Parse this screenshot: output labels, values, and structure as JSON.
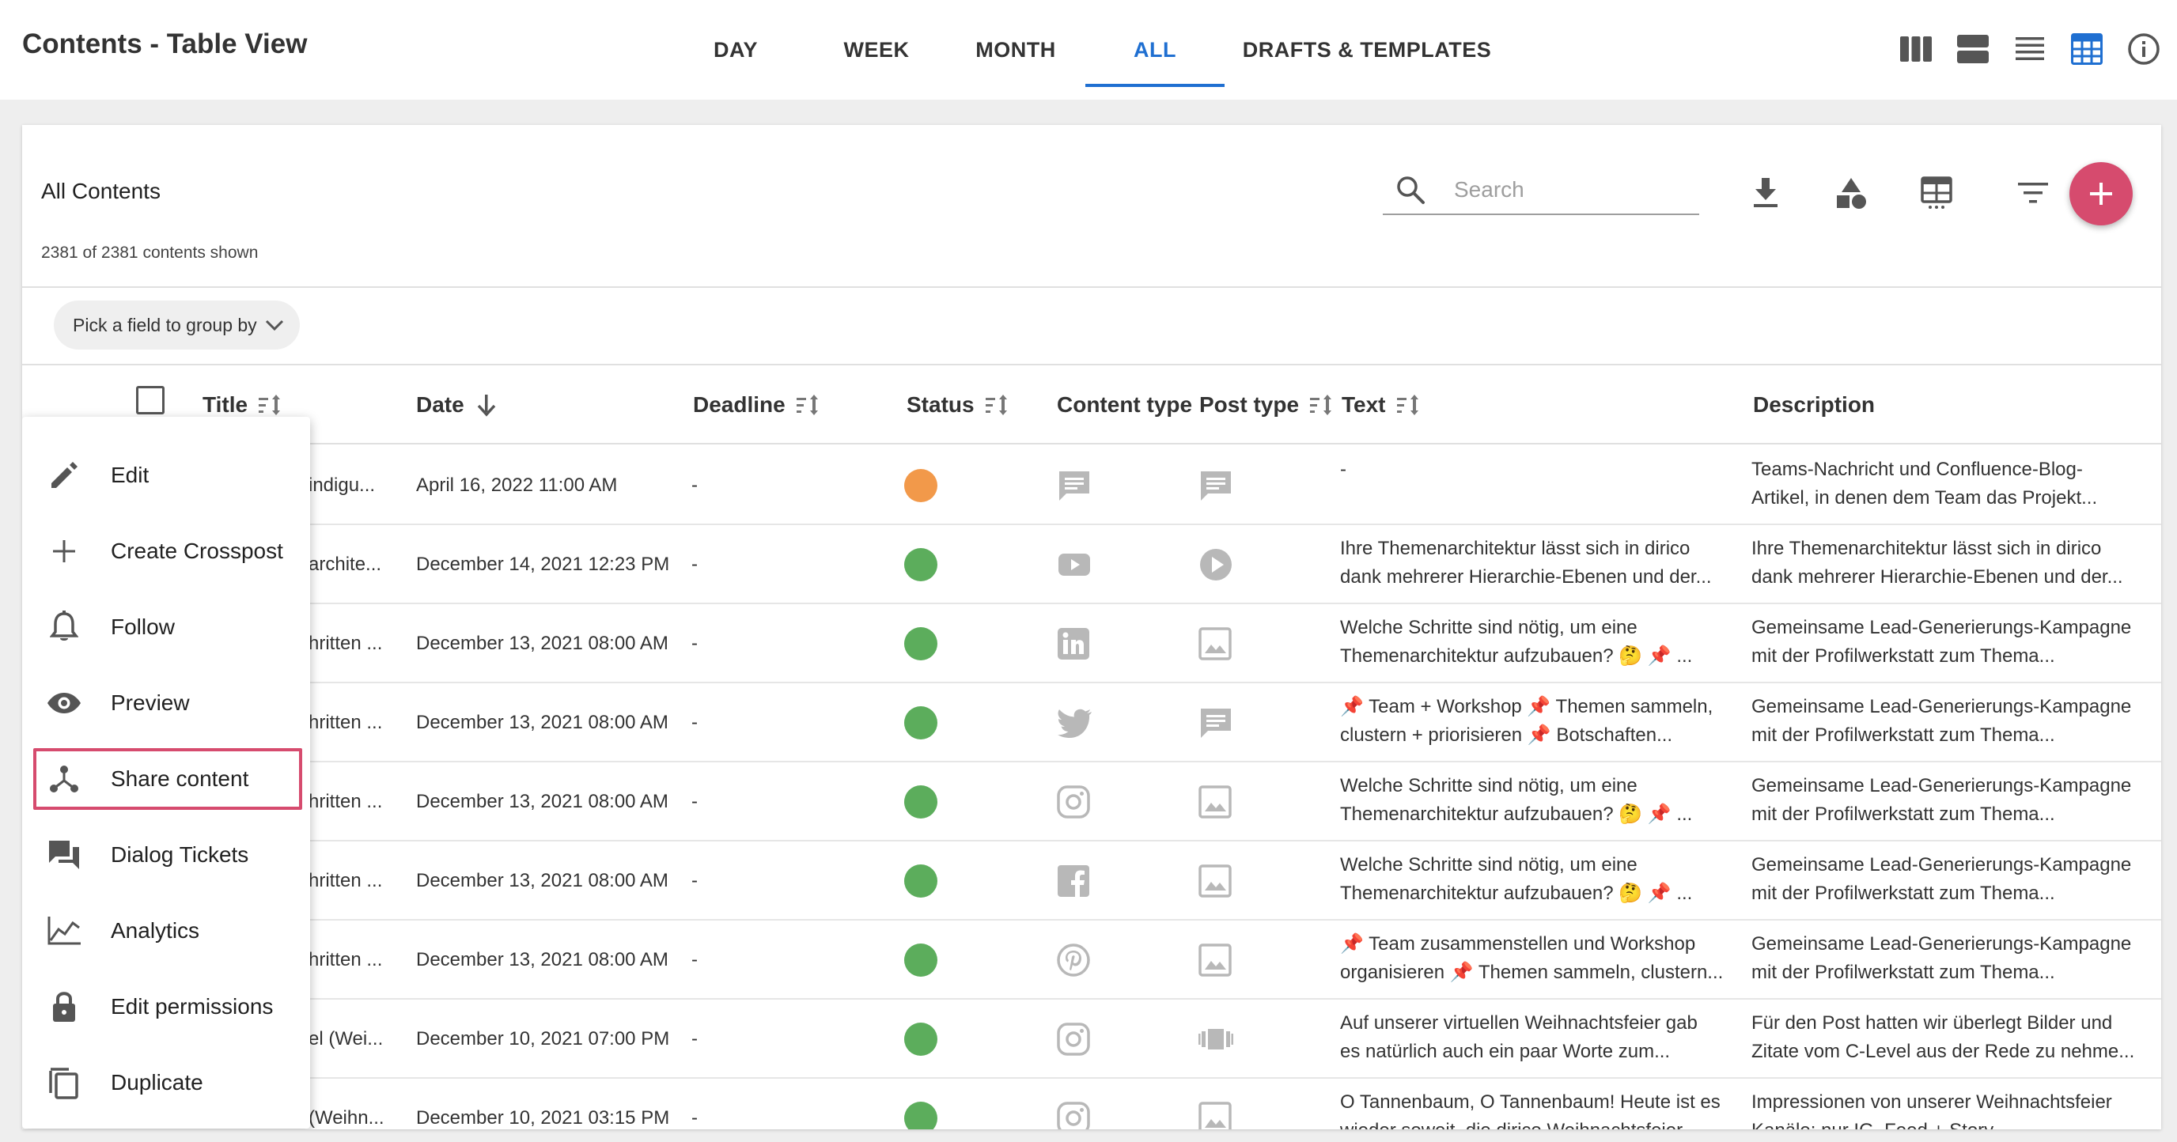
{
  "header": {
    "title": "Contents - Table View",
    "tabs": [
      {
        "label": "DAY"
      },
      {
        "label": "WEEK"
      },
      {
        "label": "MONTH"
      },
      {
        "label": "ALL"
      },
      {
        "label": "DRAFTS & TEMPLATES"
      }
    ],
    "active_tab": "ALL",
    "view_icons": [
      "columns-view-icon",
      "rows-view-icon",
      "list-view-icon",
      "table-view-icon",
      "info-icon"
    ]
  },
  "card": {
    "title": "All Contents",
    "count": "2381 of 2381 contents shown",
    "search_placeholder": "Search",
    "toolbar_icons": [
      "download-icon",
      "shapes-icon",
      "table-columns-icon",
      "filter-icon",
      "add-icon"
    ],
    "group_by": "Pick a field to group by"
  },
  "table": {
    "columns": [
      "Title",
      "Date",
      "Deadline",
      "Status",
      "Content type",
      "Post type",
      "Text",
      "Description"
    ],
    "rows": [
      {
        "title": "indigu...",
        "date": "April 16, 2022 11:00 AM",
        "deadline": "-",
        "status": "orange",
        "content_type": "message-icon",
        "post_type": "message-icon",
        "text1": "-",
        "text2": "",
        "desc1": "Teams-Nachricht und Confluence-Blog-",
        "desc2": "Artikel, in denen dem Team das Projekt..."
      },
      {
        "title": "archite...",
        "date": "December 14, 2021 12:23 PM",
        "deadline": "-",
        "status": "green",
        "content_type": "youtube-icon",
        "post_type": "play-icon",
        "text1": "Ihre Themenarchitektur lässt sich in dirico",
        "text2": "dank mehrerer Hierarchie-Ebenen und der...",
        "desc1": "Ihre Themenarchitektur lässt sich in dirico",
        "desc2": "dank mehrerer Hierarchie-Ebenen und der..."
      },
      {
        "title": "hritten ...",
        "date": "December 13, 2021 08:00 AM",
        "deadline": "-",
        "status": "green",
        "content_type": "linkedin-icon",
        "post_type": "image-icon",
        "text1": "Welche Schritte sind nötig, um eine",
        "text2": "Themenarchitektur aufzubauen? 🤔 📌 ...",
        "desc1": "Gemeinsame Lead-Generierungs-Kampagne",
        "desc2": "mit der Profilwerkstatt zum Thema..."
      },
      {
        "title": "hritten ...",
        "date": "December 13, 2021 08:00 AM",
        "deadline": "-",
        "status": "green",
        "content_type": "twitter-icon",
        "post_type": "message-icon",
        "text1": "📌 Team + Workshop 📌 Themen sammeln,",
        "text2": "clustern + priorisieren 📌 Botschaften...",
        "desc1": "Gemeinsame Lead-Generierungs-Kampagne",
        "desc2": "mit der Profilwerkstatt zum Thema..."
      },
      {
        "title": "hritten ...",
        "date": "December 13, 2021 08:00 AM",
        "deadline": "-",
        "status": "green",
        "content_type": "instagram-icon",
        "post_type": "image-icon",
        "text1": "Welche Schritte sind nötig, um eine",
        "text2": "Themenarchitektur aufzubauen? 🤔 📌 ...",
        "desc1": "Gemeinsame Lead-Generierungs-Kampagne",
        "desc2": "mit der Profilwerkstatt zum Thema..."
      },
      {
        "title": "hritten ...",
        "date": "December 13, 2021 08:00 AM",
        "deadline": "-",
        "status": "green",
        "content_type": "facebook-icon",
        "post_type": "image-icon",
        "text1": "Welche Schritte sind nötig, um eine",
        "text2": "Themenarchitektur aufzubauen? 🤔 📌 ...",
        "desc1": "Gemeinsame Lead-Generierungs-Kampagne",
        "desc2": "mit der Profilwerkstatt zum Thema..."
      },
      {
        "title": "hritten ...",
        "date": "December 13, 2021 08:00 AM",
        "deadline": "-",
        "status": "green",
        "content_type": "pinterest-icon",
        "post_type": "image-icon",
        "text1": "📌 Team zusammenstellen und Workshop",
        "text2": "organisieren 📌 Themen sammeln, clustern...",
        "desc1": "Gemeinsame Lead-Generierungs-Kampagne",
        "desc2": "mit der Profilwerkstatt zum Thema..."
      },
      {
        "title": "el (Wei...",
        "date": "December 10, 2021 07:00 PM",
        "deadline": "-",
        "status": "green",
        "content_type": "instagram-icon",
        "post_type": "carousel-icon",
        "text1": "Auf unserer virtuellen Weihnachtsfeier gab",
        "text2": "es natürlich auch ein paar Worte zum...",
        "desc1": "Für den Post hatten wir überlegt Bilder und",
        "desc2": "Zitate vom C-Level aus der Rede zu nehme..."
      },
      {
        "title": "(Weihn...",
        "date": "December 10, 2021 03:15 PM",
        "deadline": "-",
        "status": "green",
        "content_type": "instagram-icon",
        "post_type": "image-icon",
        "text1": "O Tannenbaum, O Tannenbaum! Heute ist es",
        "text2": "wieder soweit, die dirico Weihnachtsfeier...",
        "desc1": "Impressionen von unserer Weihnachtsfeier",
        "desc2": "Kanäle: nur IG, Feed + Story"
      }
    ]
  },
  "menu": {
    "items": [
      {
        "label": "Edit",
        "icon": "pencil-icon"
      },
      {
        "label": "Create Crosspost",
        "icon": "plus-icon"
      },
      {
        "label": "Follow",
        "icon": "bell-icon"
      },
      {
        "label": "Preview",
        "icon": "eye-icon"
      },
      {
        "label": "Share content",
        "icon": "share-icon"
      },
      {
        "label": "Dialog Tickets",
        "icon": "chat-icon"
      },
      {
        "label": "Analytics",
        "icon": "chart-icon"
      },
      {
        "label": "Edit permissions",
        "icon": "lock-icon"
      },
      {
        "label": "Duplicate",
        "icon": "copy-icon"
      }
    ],
    "highlighted": "Share content"
  },
  "colors": {
    "accent_blue": "#1f6fd1",
    "fab_pink": "#d64b6e",
    "status_green": "#5cad5c",
    "status_orange": "#f2994a",
    "icon_gray": "#b8b8b8"
  }
}
